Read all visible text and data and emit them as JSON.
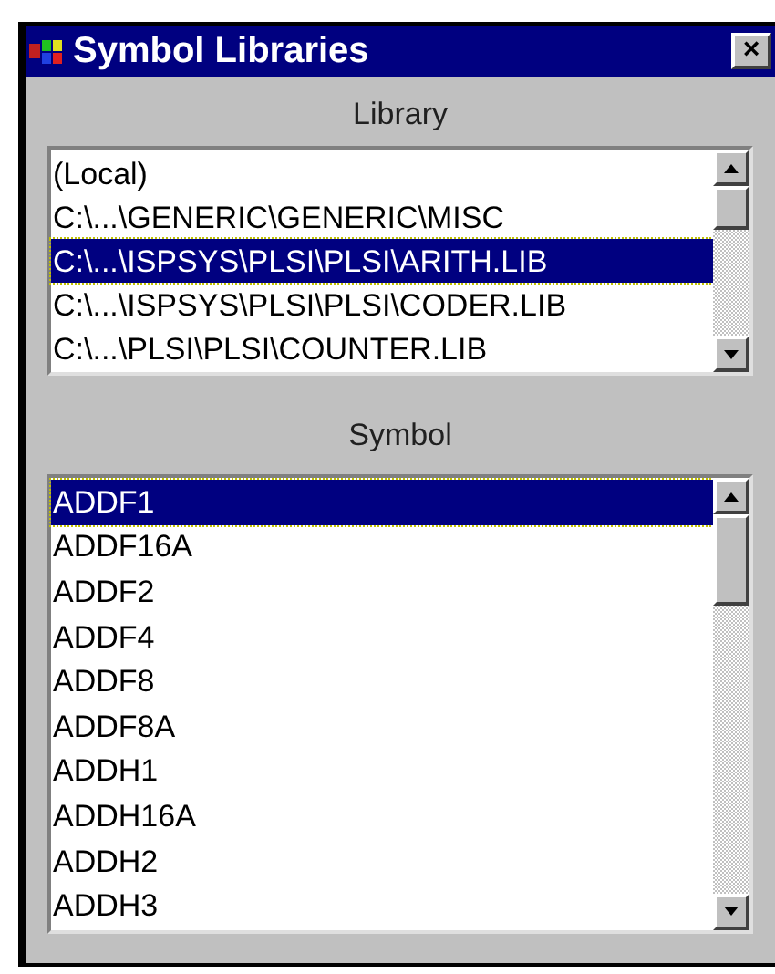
{
  "window": {
    "title": "Symbol Libraries",
    "close": "×"
  },
  "library": {
    "label": "Library",
    "items": [
      {
        "text": "(Local)",
        "selected": false
      },
      {
        "text": "C:\\...\\GENERIC\\GENERIC\\MISC",
        "selected": false
      },
      {
        "text": "C:\\...\\ISPSYS\\PLSI\\PLSI\\ARITH.LIB",
        "selected": true
      },
      {
        "text": "C:\\...\\ISPSYS\\PLSI\\PLSI\\CODER.LIB",
        "selected": false
      },
      {
        "text": "C:\\...\\PLSI\\PLSI\\COUNTER.LIB",
        "selected": false
      }
    ]
  },
  "symbol": {
    "label": "Symbol",
    "items": [
      {
        "text": "ADDF1",
        "selected": true
      },
      {
        "text": "ADDF16A",
        "selected": false
      },
      {
        "text": "ADDF2",
        "selected": false
      },
      {
        "text": "ADDF4",
        "selected": false
      },
      {
        "text": "ADDF8",
        "selected": false
      },
      {
        "text": "ADDF8A",
        "selected": false
      },
      {
        "text": "ADDH1",
        "selected": false
      },
      {
        "text": "ADDH16A",
        "selected": false
      },
      {
        "text": "ADDH2",
        "selected": false
      },
      {
        "text": "ADDH3",
        "selected": false
      }
    ]
  }
}
